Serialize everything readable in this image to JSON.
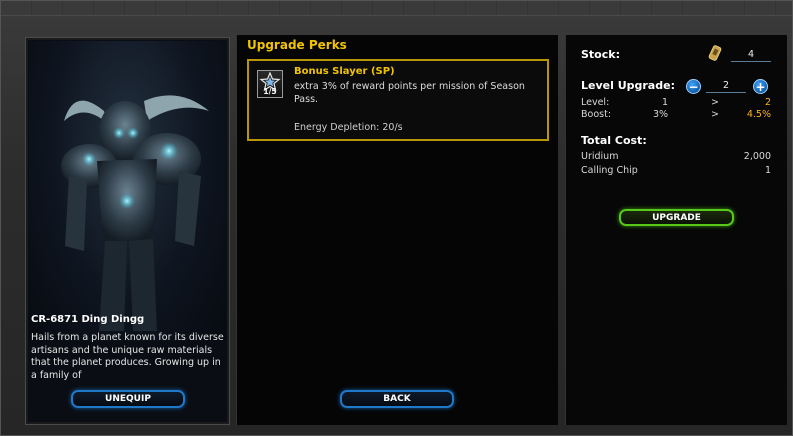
{
  "character": {
    "name": "CR-6871 Ding Dingg",
    "description": "Hails from a planet known for its diverse artisans and the unique raw materials that the planet produces. Growing up in a family of",
    "unequip_label": "UNEQUIP"
  },
  "perks": {
    "title": "Upgrade Perks",
    "items": [
      {
        "name": "Bonus Slayer (SP)",
        "description": "extra 3% of reward points per mission of Season Pass.",
        "energy": "Energy Depletion: 20/s",
        "level": "1/5",
        "icon": "star-chevron-icon"
      }
    ],
    "back_label": "BACK"
  },
  "upgrade": {
    "stock_label": "Stock:",
    "stock_value": "4",
    "level_upgrade_label": "Level Upgrade:",
    "level_upgrade_value": "2",
    "level_label": "Level:",
    "level_from": "1",
    "level_arrow": ">",
    "level_to": "2",
    "boost_label": "Boost:",
    "boost_from": "3%",
    "boost_arrow": ">",
    "boost_to": "4.5%",
    "total_cost_label": "Total Cost:",
    "costs": [
      {
        "name": "Uridium",
        "value": "2,000"
      },
      {
        "name": "Calling Chip",
        "value": "1"
      }
    ],
    "upgrade_label": "UPGRADE",
    "minus_glyph": "−",
    "plus_glyph": "+"
  },
  "colors": {
    "accent_gold": "#f2c400",
    "accent_blue": "#1f78c8",
    "accent_green": "#58c81a",
    "highlight": "#ffb020"
  }
}
